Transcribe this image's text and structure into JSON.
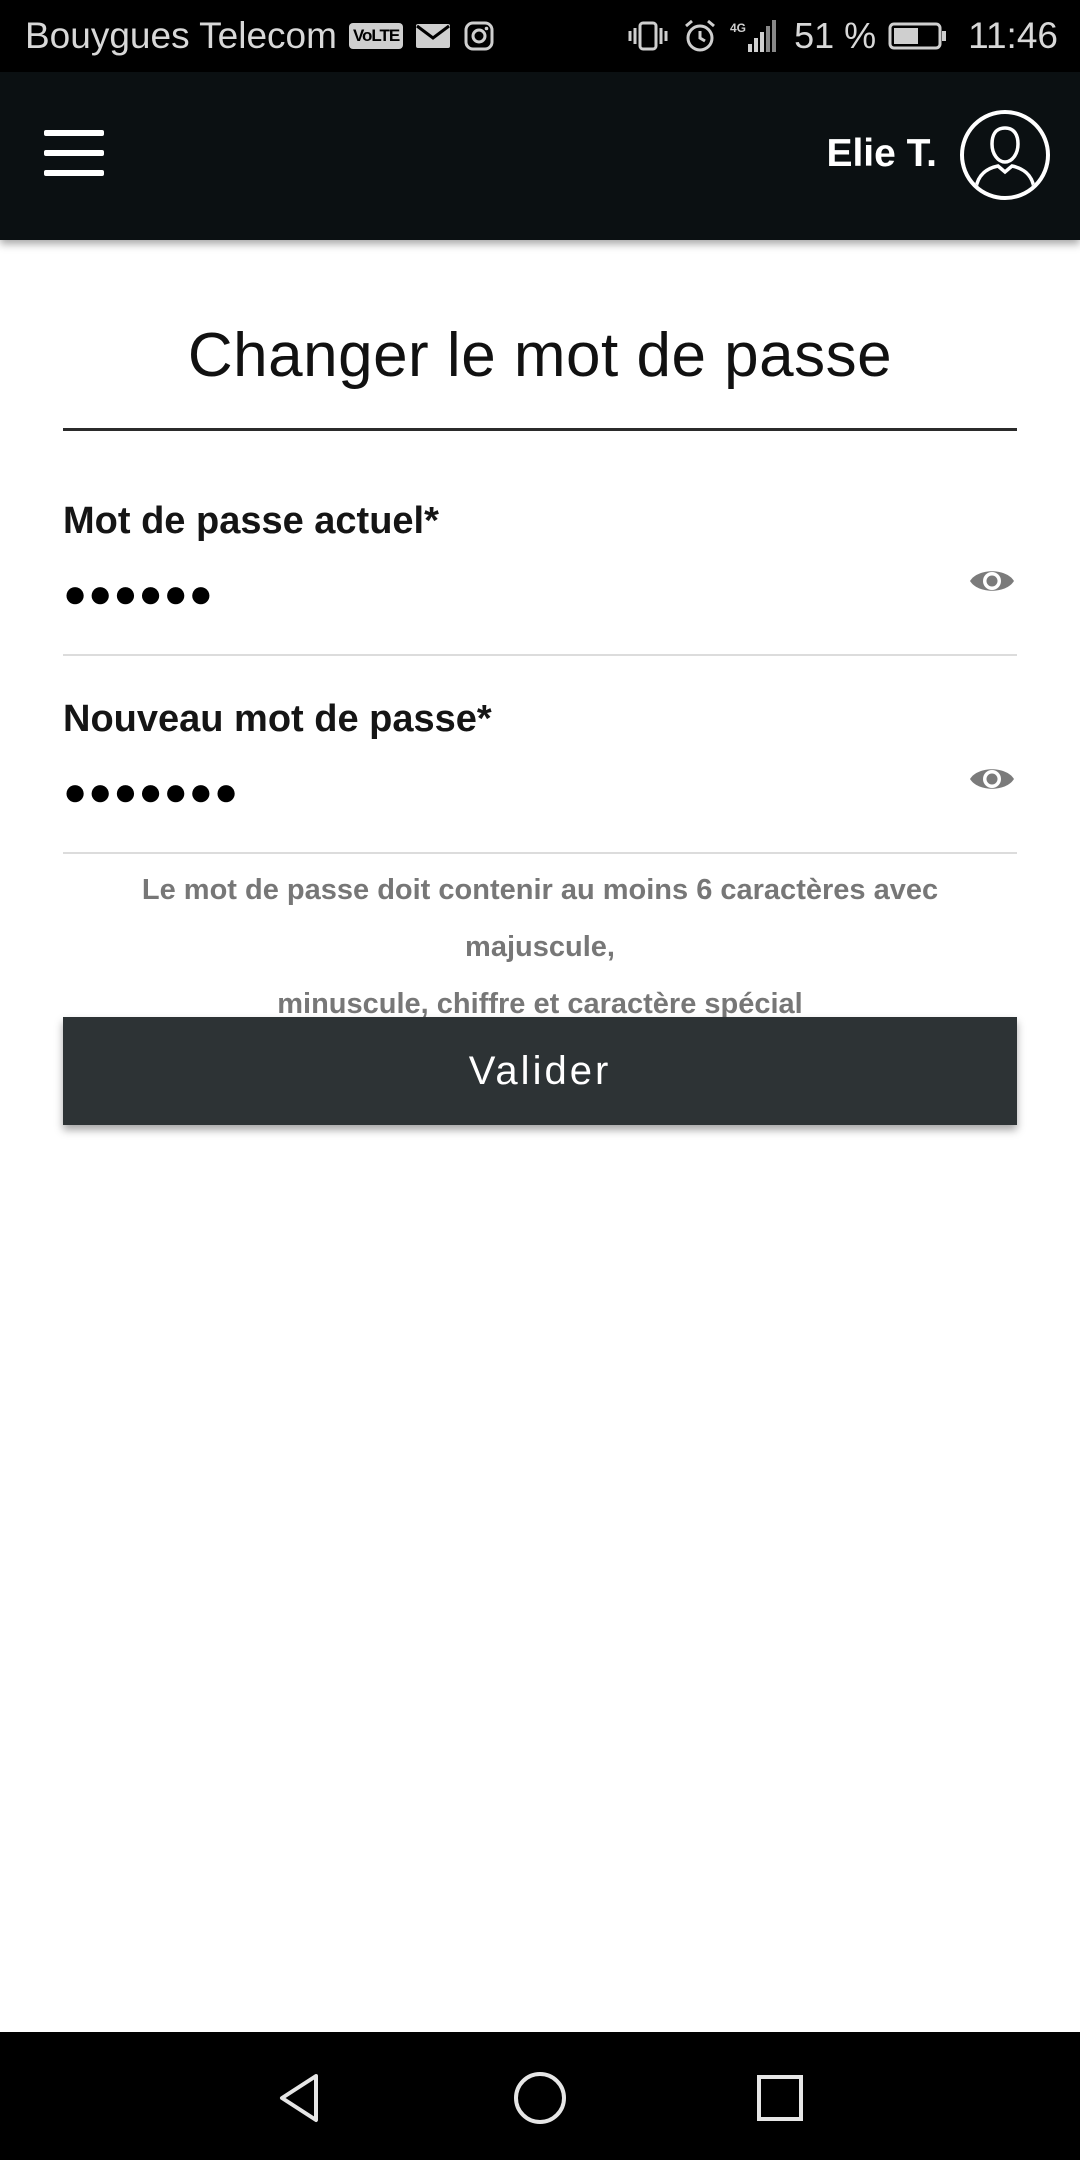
{
  "status_bar": {
    "carrier": "Bouygues Telecom",
    "volte_badge": "VoLTE",
    "network_type": "4G",
    "battery_percent": "51 %",
    "time": "11:46",
    "icons": [
      "volte-icon",
      "mail-icon",
      "instagram-icon",
      "vibrate-icon",
      "alarm-icon",
      "signal-icon",
      "battery-icon"
    ]
  },
  "header": {
    "menu_icon": "hamburger-menu-icon",
    "user_name": "Elie T.",
    "avatar_icon": "user-avatar-icon"
  },
  "page": {
    "title": "Changer le mot de passe"
  },
  "form": {
    "current_password": {
      "label": "Mot de passe actuel*",
      "value_masked": "●●●●●●"
    },
    "new_password": {
      "label": "Nouveau mot de passe*",
      "value_masked": "●●●●●●●"
    },
    "hint_line1": "Le mot de passe doit contenir au moins 6 caractères avec majuscule,",
    "hint_line2": "minuscule, chiffre et caractère spécial",
    "submit_label": "Valider"
  },
  "nav_bar": {
    "back_icon": "back-triangle-icon",
    "home_icon": "home-circle-icon",
    "recents_icon": "recents-square-icon"
  },
  "colors": {
    "header_bg": "#0b1012",
    "button_bg": "#2d3335",
    "hint_text": "#777777"
  }
}
